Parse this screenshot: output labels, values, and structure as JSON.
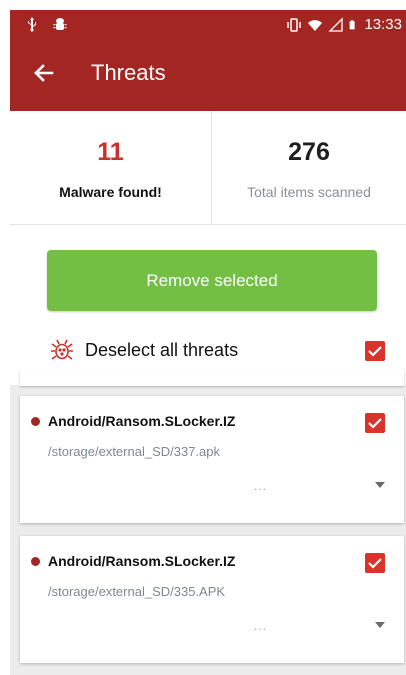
{
  "status_bar": {
    "time": "13:33",
    "left_icons": [
      "usb-icon",
      "android-debug-icon"
    ],
    "right_icons": [
      "vibrate-icon",
      "wifi-icon",
      "signal-icon",
      "battery-icon"
    ]
  },
  "app_bar": {
    "title": "Threats",
    "back_icon": "back-arrow-icon"
  },
  "stats": {
    "malware_count": "11",
    "malware_label": "Malware found!",
    "scanned_count": "276",
    "scanned_label": "Total items scanned"
  },
  "actions": {
    "remove_label": "Remove selected",
    "deselect_label": "Deselect all threats",
    "deselect_checked": true
  },
  "threats": [
    {
      "name": "Android/Ransom.SLocker.IZ",
      "path": "/storage/external_SD/337.apk",
      "more": "...",
      "checked": true
    },
    {
      "name": "Android/Ransom.SLocker.IZ",
      "path": "/storage/external_SD/335.APK",
      "more": "...",
      "checked": true
    }
  ],
  "colors": {
    "brand": "#a32622",
    "malware_number": "#c9312b",
    "button_green": "#72bf44",
    "checkbox_red": "#d9342b"
  }
}
